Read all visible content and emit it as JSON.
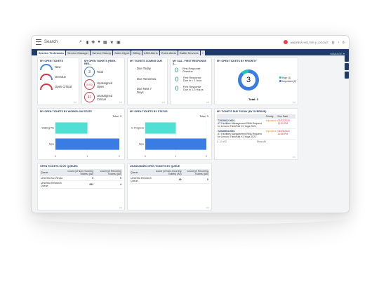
{
  "topbar": {
    "search_label": "Search",
    "user_text": "ANDREW HELTER | LOGOUT"
  },
  "tabs": [
    "Service Technician",
    "Service Manager",
    "Service History",
    "Sales Mgmt",
    "Billing",
    "ASM Alerts",
    "Rules Alerts",
    "Battle Services"
  ],
  "tabs_right": "MANAGE ▾",
  "open_tickets": {
    "title": "MY OPEN TICKETS",
    "items": [
      {
        "label": "New"
      },
      {
        "label": "Overdue"
      },
      {
        "label": "Open Critical"
      }
    ]
  },
  "high_res": {
    "title": "MY OPEN TICKETS (HIGH-RES...",
    "items": [
      {
        "value": "3",
        "label": "Total"
      },
      {
        "value": "0.000",
        "label": "Unassigned Open"
      },
      {
        "value": "41",
        "label": "Unassigned Critical"
      }
    ]
  },
  "coming_due": {
    "title": "MY TICKETS COMING DUE",
    "items": [
      "Due Today",
      "Due Tomorrow",
      "Due Next 7 Days"
    ]
  },
  "sla": {
    "title": "MY SLA - FIRST RESPONSE S...",
    "items": [
      {
        "value": "0",
        "label": "First Response Overdue"
      },
      {
        "value": "0",
        "label": "First Response Due in < 1 hour"
      },
      {
        "value": "0",
        "label": "First Response Due in 1-3 Hours"
      }
    ]
  },
  "priority": {
    "title": "MY OPEN TICKETS BY PRIORITY",
    "center": "3",
    "legend": [
      "High (1)",
      "Important (2)"
    ],
    "total": "Total: 3"
  },
  "chart_data": [
    {
      "type": "bar",
      "title": "MY OPEN TICKETS BY WORKFLOW STATE",
      "total": "Total: 3",
      "categories": [
        "Waiting Pts",
        "New"
      ],
      "values": [
        1,
        2
      ],
      "ticks": [
        "0",
        "1",
        "2"
      ],
      "xlim": [
        0,
        2
      ],
      "colors": [
        "#4fe0d3",
        "#3b7be4"
      ]
    },
    {
      "type": "bar",
      "title": "MY OPEN TICKETS BY STATUS",
      "total": "Total: 3",
      "categories": [
        "In Progress",
        "New"
      ],
      "values": [
        1,
        2
      ],
      "ticks": [
        "0",
        "1",
        "2"
      ],
      "xlim": [
        0,
        2
      ],
      "colors": [
        "#4fe0d3",
        "#3b7be4"
      ]
    }
  ],
  "due_today": {
    "title": "MY TICKETS DUE TODAY (BY OVERDUE)",
    "headers": [
      "Priority",
      "Due Date"
    ],
    "rows": [
      {
        "id": "T2020812.0001",
        "priority": "Important",
        "date": "02/22/2020 11:30 PM",
        "desc": "AT Facilities Management RMA Request for Lenovo ThinkPad X1 Yoga 2021"
      },
      {
        "id": "T2020804.0001",
        "priority": "Important",
        "date": "04/05/2020 11:58 PM",
        "desc": "AT Facilities Management RMA Request for Lenovo ThinkPad X1 Yoga 2021"
      }
    ],
    "footer": "1 - 2 of 2",
    "show_all": "Show All"
  },
  "queues": {
    "title": "OPEN TICKETS IN MY QUEUES",
    "headers": [
      "Queue",
      "Count (of Non-recurring Tickets) (All)",
      "Count (of Recurring Tickets) (All)"
    ],
    "rows": [
      {
        "queue": "Umbrella No Vendor",
        "a": "0",
        "b": "0"
      },
      {
        "queue": "Umbrella Research Queue",
        "a": "262",
        "b": "4"
      }
    ]
  },
  "unassigned": {
    "title": "UNASSIGNED OPEN TICKETS BY QUEUE",
    "headers": [
      "Queue",
      "Count (of Non-recurring Tickets) (All)",
      "Count (of Recurring Tickets) (All)"
    ],
    "rows": [
      {
        "queue": "Umbrella Research Queue",
        "a": "49",
        "b": "0"
      }
    ]
  },
  "colors": {
    "navy": "#1f3b6a",
    "blue": "#3b7be4",
    "teal": "#4fe0d3",
    "red": "#d93545",
    "green": "#1b8a6b"
  }
}
